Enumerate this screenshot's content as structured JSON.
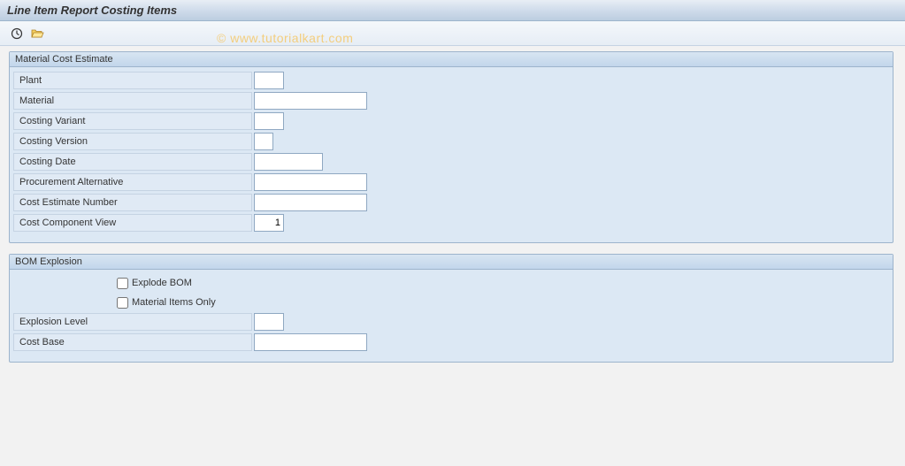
{
  "title": "Line Item Report Costing Items",
  "watermark": "© www.tutorialkart.com",
  "groups": {
    "mce": {
      "header": "Material Cost Estimate",
      "plant_label": "Plant",
      "plant_value": "",
      "material_label": "Material",
      "material_value": "",
      "costing_variant_label": "Costing Variant",
      "costing_variant_value": "",
      "costing_version_label": "Costing Version",
      "costing_version_value": "",
      "costing_date_label": "Costing Date",
      "costing_date_value": "",
      "proc_alt_label": "Procurement Alternative",
      "proc_alt_value": "",
      "cost_est_num_label": "Cost Estimate Number",
      "cost_est_num_value": "",
      "cost_comp_view_label": "Cost Component View",
      "cost_comp_view_value": "1"
    },
    "bom": {
      "header": "BOM Explosion",
      "explode_bom_label": "Explode BOM",
      "material_items_label": "Material Items Only",
      "explosion_level_label": "Explosion Level",
      "explosion_level_value": "",
      "cost_base_label": "Cost Base",
      "cost_base_value": ""
    }
  }
}
